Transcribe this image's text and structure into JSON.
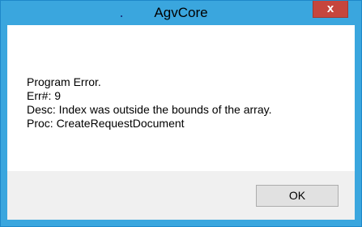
{
  "window": {
    "title": "AgvCore",
    "close_label": "x"
  },
  "message": {
    "line1": "Program Error.",
    "line2": "Err#: 9",
    "line3": "Desc: Index was outside the bounds of the array.",
    "line4": "Proc: CreateRequestDocument"
  },
  "buttons": {
    "ok_label": "OK"
  },
  "colors": {
    "titlebar": "#3aa6de",
    "close_button": "#c6463d",
    "footer": "#f0f0f0"
  }
}
